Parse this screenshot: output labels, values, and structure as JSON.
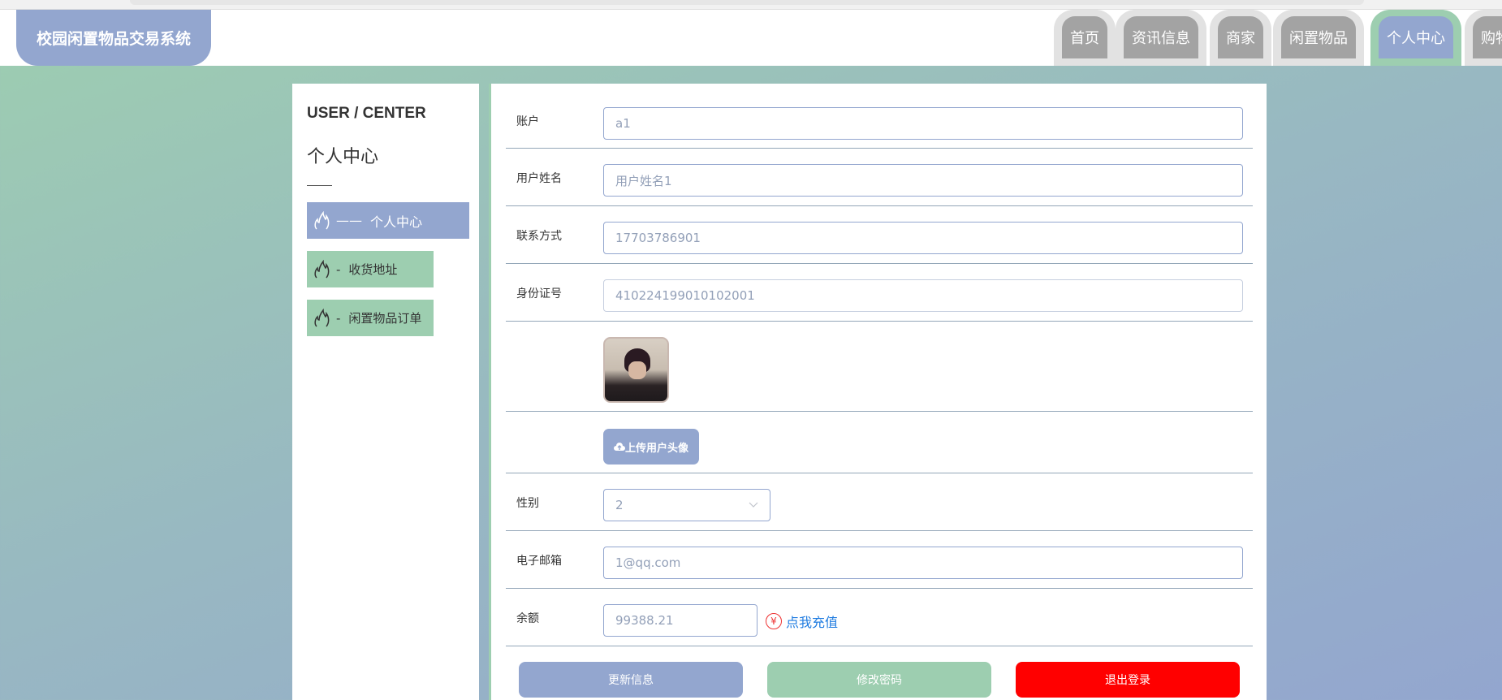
{
  "header": {
    "title": "校园闲置物品交易系统",
    "nav": [
      {
        "label": "首页"
      },
      {
        "label": "资讯信息"
      },
      {
        "label": "商家"
      },
      {
        "label": "闲置物品"
      },
      {
        "label": "个人中心",
        "active": true
      },
      {
        "label": "购物车"
      }
    ]
  },
  "sidebar": {
    "title_en": "USER / CENTER",
    "title": "个人中心",
    "items": [
      {
        "label": "个人中心",
        "prefix": "——",
        "active": true
      },
      {
        "label": "收货地址",
        "prefix": "-"
      },
      {
        "label": "闲置物品订单",
        "prefix": "-"
      }
    ]
  },
  "form": {
    "account": {
      "label": "账户",
      "value": "a1"
    },
    "name": {
      "label": "用户姓名",
      "value": "用户姓名1"
    },
    "phone": {
      "label": "联系方式",
      "value": "17703786901"
    },
    "idcard": {
      "label": "身份证号",
      "value": "410224199010102001"
    },
    "upload_label": "上传用户头像",
    "gender": {
      "label": "性别",
      "value": "2"
    },
    "email": {
      "label": "电子邮箱",
      "value": "1@qq.com"
    },
    "balance": {
      "label": "余额",
      "value": "99388.21",
      "recharge": "点我充值"
    },
    "buttons": {
      "update": "更新信息",
      "password": "修改密码",
      "logout": "退出登录"
    }
  },
  "colors": {
    "primary": "#93a6cf",
    "secondary": "#9dceb0",
    "danger": "#ff0000",
    "link": "#1e7be0"
  }
}
